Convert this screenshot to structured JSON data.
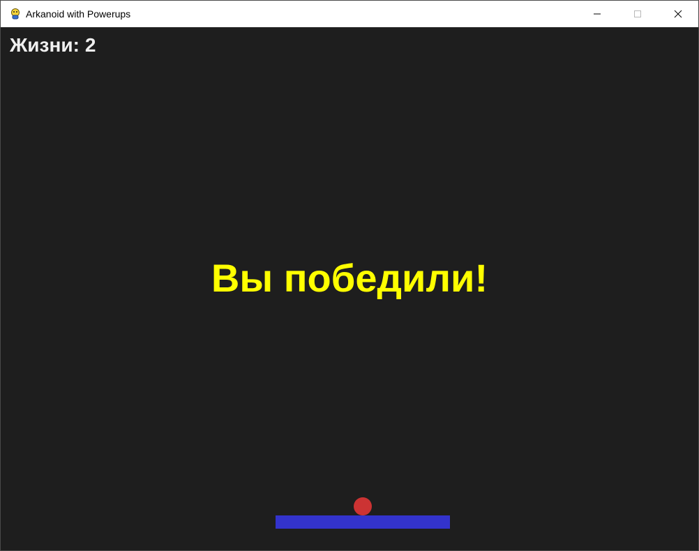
{
  "window": {
    "title": "Arkanoid with Powerups",
    "app_icon": "pygame-snake-icon",
    "controls": {
      "minimize_icon": "minimize-icon",
      "maximize_icon": "maximize-icon",
      "close_icon": "close-icon"
    }
  },
  "hud": {
    "lives_label": "Жизни:",
    "lives_value": "2"
  },
  "game": {
    "message": "Вы победили!",
    "colors": {
      "background": "#1e1e1e",
      "message": "#ffff00",
      "hud_text": "#f0f0f0",
      "ball": "#cc3333",
      "paddle": "#3333cc"
    }
  }
}
